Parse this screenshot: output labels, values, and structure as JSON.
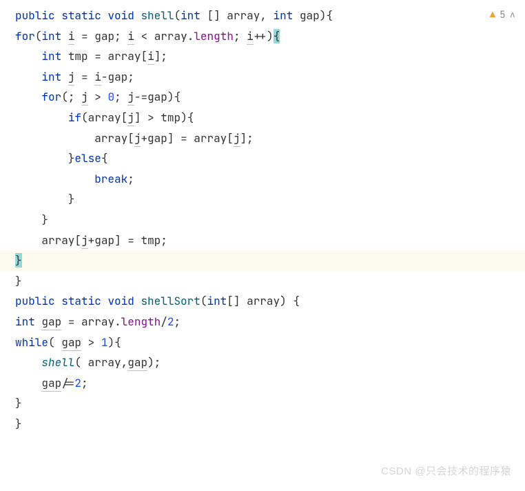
{
  "editor": {
    "warnings_count": "5",
    "lines": {
      "l1": {
        "public": "public",
        "static": "static",
        "void": "void",
        "method": "shell",
        "paren_open": "(",
        "int1": "int",
        "brackets": " [] ",
        "array": "array",
        "comma": ", ",
        "int2": "int",
        "space": " ",
        "gap": "gap",
        "paren_close": ")",
        "brace": "{"
      },
      "l2": {
        "for": "for",
        "paren_open": "(",
        "int": "int",
        "sp1": " ",
        "i1": "i",
        "eq": " = ",
        "gap": "gap",
        "semi1": "; ",
        "i2": "i",
        "lt": " < ",
        "array": "array",
        "dot": ".",
        "length": "length",
        "semi2": "; ",
        "i3": "i",
        "inc": "++",
        "paren_close": ")",
        "brace": "{"
      },
      "l3": {
        "int": "int",
        "sp": " ",
        "tmp": "tmp",
        "eq": " = ",
        "array": "array",
        "bopen": "[",
        "i": "i",
        "bclose": "]",
        "semi": ";"
      },
      "l4": {
        "int": "int",
        "sp": " ",
        "j": "j",
        "eq": " = ",
        "i": "i",
        "minus": "-",
        "gap": "gap",
        "semi": ";"
      },
      "l5": {
        "for": "for",
        "paren_open": "(",
        "semi1": "; ",
        "j1": "j",
        "gt": " > ",
        "zero": "0",
        "semi2": "; ",
        "j2": "j",
        "comp": "-=",
        "gap": "gap",
        "paren_close": ")",
        "brace": "{"
      },
      "l6": {
        "if": "if",
        "paren_open": "(",
        "array": "array",
        "bopen": "[",
        "j": "j",
        "bclose": "]",
        "gt": " > ",
        "tmp": "tmp",
        "paren_close": ")",
        "brace": "{"
      },
      "l7": {
        "array1": "array",
        "bopen1": "[",
        "j1": "j",
        "plus": "+",
        "gap": "gap",
        "bclose1": "]",
        "eq": " = ",
        "array2": "array",
        "bopen2": "[",
        "j2": "j",
        "bclose2": "]",
        "semi": ";"
      },
      "l8": {
        "brace": "}",
        "else": "else",
        "brace2": "{"
      },
      "l9": {
        "break": "break",
        "semi": ";"
      },
      "l10": {
        "brace": "}"
      },
      "l11": {
        "brace": "}"
      },
      "l12": {
        "array": "array",
        "bopen": "[",
        "j": "j",
        "plus": "+",
        "gap": "gap",
        "bclose": "]",
        "eq": " = ",
        "tmp": "tmp",
        "semi": ";"
      },
      "l13": {
        "brace": "}"
      },
      "l14": {
        "brace": "}"
      },
      "l15": {
        "public": "public",
        "static": "static",
        "void": "void",
        "method": "shellSort",
        "paren_open": "(",
        "int": "int",
        "brackets": "[] ",
        "array": "array",
        "paren_close": ")",
        "sp": " ",
        "brace": "{"
      },
      "l16": {
        "int": "int",
        "sp": " ",
        "gap": "gap",
        "eq": " = ",
        "array": "array",
        "dot": ".",
        "length": "length",
        "div": "/",
        "two": "2",
        "semi": ";"
      },
      "l17": {
        "while": "while",
        "paren_open": "( ",
        "gap": "gap",
        "gt": " > ",
        "one": "1",
        "paren_close": ")",
        "brace": "{"
      },
      "l18": {
        "shell": "shell",
        "paren_open": "( ",
        "array": "array",
        "comma": ",",
        "gap": "gap",
        "paren_close": ")",
        "semi": ";"
      },
      "l19": {
        "gap": "gap",
        "div": "/=",
        "two": "2",
        "semi": ";"
      },
      "l20": {
        "brace": "}"
      },
      "l21": {
        "brace": "}"
      }
    }
  },
  "watermark": "CSDN @只会技术的程序猿"
}
